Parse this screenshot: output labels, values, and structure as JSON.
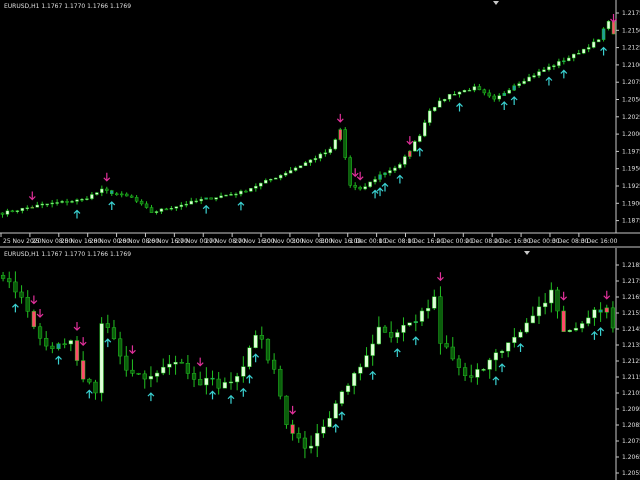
{
  "chart_data": [
    {
      "type": "candlestick",
      "title": "EURUSD,H1 1.1767 1.1770 1.1766 1.1769",
      "symbol": "EURUSD",
      "timeframe": "H1",
      "ylim": [
        1.1862,
        1.219
      ],
      "y_ticks": [
        "1.2175",
        "1.2150",
        "1.2125",
        "1.2100",
        "1.2075",
        "1.2050",
        "1.2025",
        "1.2000",
        "1.1975",
        "1.1950",
        "1.1925",
        "1.1900",
        "1.1875"
      ],
      "x_ticks": [
        "25 Nov 2020",
        "25 Nov 08:00",
        "25 Nov 16:00",
        "26 Nov 00:00",
        "26 Nov 08:00",
        "26 Nov 16:00",
        "27 Nov 00:00",
        "27 Nov 08:00",
        "27 Nov 16:00",
        "30 Nov 00:00",
        "30 Nov 08:00",
        "30 Nov 16:00",
        "1 Dec 00:00",
        "1 Dec 08:00",
        "1 Dec 16:00",
        "2 Dec 00:00",
        "2 Dec 08:00",
        "2 Dec 16:00",
        "3 Dec 00:00",
        "3 Dec 08:00",
        "3 Dec 16:00"
      ],
      "candle_count": 124,
      "close_keypoints": [
        [
          0,
          1.1886
        ],
        [
          8,
          1.1898
        ],
        [
          16,
          1.1905
        ],
        [
          20,
          1.1919
        ],
        [
          26,
          1.1908
        ],
        [
          30,
          1.1887
        ],
        [
          40,
          1.1905
        ],
        [
          48,
          1.1916
        ],
        [
          56,
          1.1941
        ],
        [
          60,
          1.1955
        ],
        [
          66,
          1.1977
        ],
        [
          68,
          1.2006
        ],
        [
          70,
          1.1926
        ],
        [
          72,
          1.1919
        ],
        [
          76,
          1.1941
        ],
        [
          80,
          1.1955
        ],
        [
          84,
          1.1999
        ],
        [
          86,
          1.2035
        ],
        [
          90,
          1.2057
        ],
        [
          95,
          1.2067
        ],
        [
          99,
          1.2049
        ],
        [
          103,
          1.2071
        ],
        [
          109,
          1.2093
        ],
        [
          115,
          1.2114
        ],
        [
          120,
          1.2136
        ],
        [
          122,
          1.2165
        ],
        [
          123,
          1.2143
        ]
      ],
      "sell_arrows": [
        6,
        21,
        68,
        71,
        72,
        82,
        123
      ],
      "buy_arrows": [
        15,
        22,
        41,
        48,
        75,
        76,
        77,
        80,
        84,
        92,
        101,
        103,
        110,
        113,
        121
      ]
    },
    {
      "type": "candlestick",
      "title": "EURUSD,H1 1.1767 1.1770 1.1766 1.1769",
      "symbol": "EURUSD",
      "timeframe": "H1",
      "ylim": [
        1.205,
        1.2195
      ],
      "y_ticks": [
        "1.2185",
        "1.2175",
        "1.2165",
        "1.2155",
        "1.2145",
        "1.2135",
        "1.2125",
        "1.2115",
        "1.2105",
        "1.2095",
        "1.2085",
        "1.2075",
        "1.2065",
        "1.2055"
      ],
      "candle_count": 100,
      "close_keypoints": [
        [
          0,
          1.2179
        ],
        [
          3,
          1.2163
        ],
        [
          6,
          1.2138
        ],
        [
          8,
          1.2132
        ],
        [
          11,
          1.2135
        ],
        [
          13,
          1.2113
        ],
        [
          15,
          1.2107
        ],
        [
          16,
          1.2151
        ],
        [
          18,
          1.2138
        ],
        [
          20,
          1.2119
        ],
        [
          23,
          1.2116
        ],
        [
          28,
          1.2126
        ],
        [
          32,
          1.2113
        ],
        [
          36,
          1.211
        ],
        [
          39,
          1.2119
        ],
        [
          41,
          1.2144
        ],
        [
          44,
          1.2119
        ],
        [
          46,
          1.2088
        ],
        [
          49,
          1.2069
        ],
        [
          52,
          1.2082
        ],
        [
          55,
          1.2107
        ],
        [
          58,
          1.2119
        ],
        [
          61,
          1.2144
        ],
        [
          63,
          1.2138
        ],
        [
          67,
          1.2151
        ],
        [
          70,
          1.2163
        ],
        [
          71,
          1.2138
        ],
        [
          74,
          1.2119
        ],
        [
          76,
          1.2113
        ],
        [
          80,
          1.2132
        ],
        [
          83,
          1.2138
        ],
        [
          86,
          1.2151
        ],
        [
          89,
          1.2169
        ],
        [
          91,
          1.2144
        ],
        [
          93,
          1.2144
        ],
        [
          96,
          1.2157
        ],
        [
          98,
          1.2157
        ],
        [
          99,
          1.2144
        ]
      ],
      "sell_arrows": [
        5,
        6,
        12,
        13,
        21,
        32,
        47,
        71,
        91,
        98
      ],
      "buy_arrows": [
        2,
        9,
        14,
        17,
        24,
        34,
        37,
        39,
        40,
        41,
        54,
        55,
        60,
        64,
        67,
        80,
        81,
        84,
        96,
        97
      ]
    }
  ],
  "colors": {
    "background": "#000000",
    "bull_body": "#dfffd8",
    "bear_body": "#0b5e0b",
    "wick": "#22c022",
    "sell_highlight": "#ff4a6a",
    "buy_highlight": "#1f9a9a",
    "sell_arrow": "#e0309a",
    "buy_arrow": "#3ad0d0",
    "axis": "#c8c8c8"
  }
}
